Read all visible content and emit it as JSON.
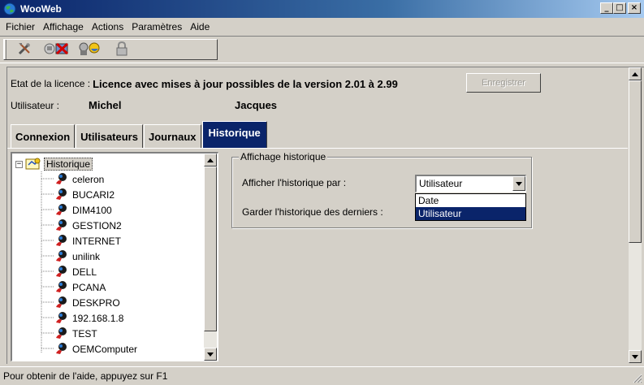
{
  "window": {
    "title": "WooWeb",
    "icon": "wooweb-globe-icon",
    "controls": {
      "minimize": "_",
      "maximize": "□",
      "close": "×"
    }
  },
  "menu": {
    "items": [
      "Fichier",
      "Affichage",
      "Actions",
      "Paramètres",
      "Aide"
    ]
  },
  "toolbar": {
    "buttons": [
      "tools-icon",
      "disconnect-icon",
      "users-icon",
      "lock-icon"
    ]
  },
  "license": {
    "label": "Etat de la licence :",
    "value": "Licence avec mises à jour possibles de la version  2.01 à 2.99",
    "register_label": "Enregistrer"
  },
  "user": {
    "label": "Utilisateur :",
    "first_name": "Michel",
    "last_name": "Jacques"
  },
  "tabs": [
    {
      "label": "Connexion",
      "active": false
    },
    {
      "label": "Utilisateurs",
      "active": false
    },
    {
      "label": "Journaux",
      "active": false
    },
    {
      "label": "Historique",
      "active": true
    }
  ],
  "tree": {
    "root": {
      "label": "Historique",
      "expander": "−"
    },
    "items": [
      "celeron",
      "BUCARI2",
      "DIM4100",
      "GESTION2",
      "INTERNET",
      "unilink",
      "DELL",
      "PCANA",
      "DESKPRO",
      "192.168.1.8",
      "TEST",
      "OEMComputer"
    ]
  },
  "history": {
    "group_title": "Affichage historique",
    "show_by_label": "Afficher l'historique par :",
    "keep_label": "Garder l'historique des derniers :",
    "show_by_value": "Utilisateur",
    "show_by_options": [
      "Date",
      "Utilisateur"
    ],
    "highlighted_option": "Utilisateur"
  },
  "status": {
    "text": "Pour obtenir de l'aide, appuyez sur F1"
  },
  "colors": {
    "title_start": "#0a246a",
    "title_end": "#a6caf0",
    "face": "#d4d0c8",
    "highlight": "#0a246a"
  }
}
